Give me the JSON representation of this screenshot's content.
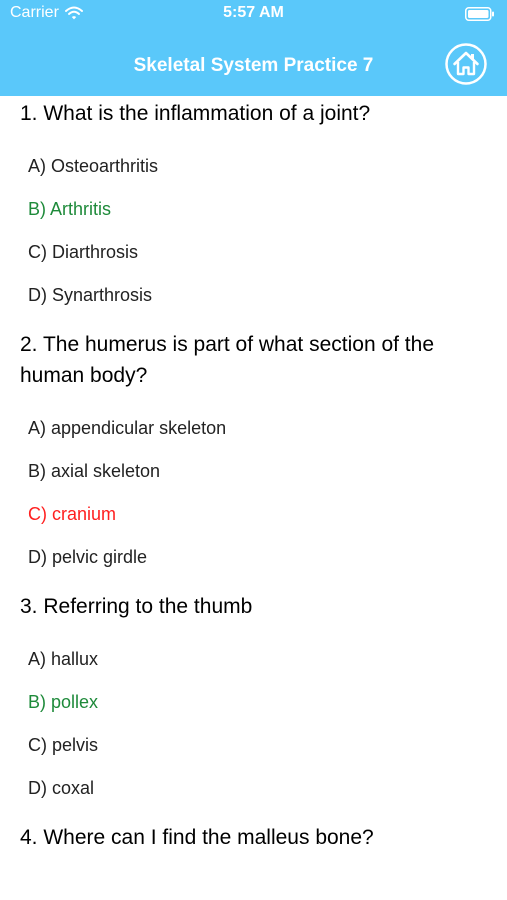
{
  "status_bar": {
    "carrier": "Carrier",
    "time": "5:57 AM"
  },
  "nav": {
    "title": "Skeletal System Practice 7",
    "home_icon": "home-icon"
  },
  "colors": {
    "header": "#5ac8fa",
    "correct": "#1e8a3a",
    "wrong": "#ff1f1f"
  },
  "questions": [
    {
      "text": "1. What is the inflammation of a joint?",
      "answers": [
        {
          "label": "A) Osteoarthritis",
          "state": "normal"
        },
        {
          "label": "B) Arthritis",
          "state": "correct"
        },
        {
          "label": "C) Diarthrosis",
          "state": "normal"
        },
        {
          "label": "D) Synarthrosis",
          "state": "normal"
        }
      ]
    },
    {
      "text": "2. The humerus is part of what section of the human body?",
      "answers": [
        {
          "label": "A) appendicular skeleton",
          "state": "normal"
        },
        {
          "label": "B) axial skeleton",
          "state": "normal"
        },
        {
          "label": "C) cranium",
          "state": "wrong"
        },
        {
          "label": "D) pelvic girdle",
          "state": "normal"
        }
      ]
    },
    {
      "text": "3. Referring to the thumb",
      "answers": [
        {
          "label": "A) hallux",
          "state": "normal"
        },
        {
          "label": "B) pollex",
          "state": "correct"
        },
        {
          "label": "C) pelvis",
          "state": "normal"
        },
        {
          "label": "D) coxal",
          "state": "normal"
        }
      ]
    },
    {
      "text": "4. Where can I find the malleus bone?",
      "answers": []
    }
  ]
}
